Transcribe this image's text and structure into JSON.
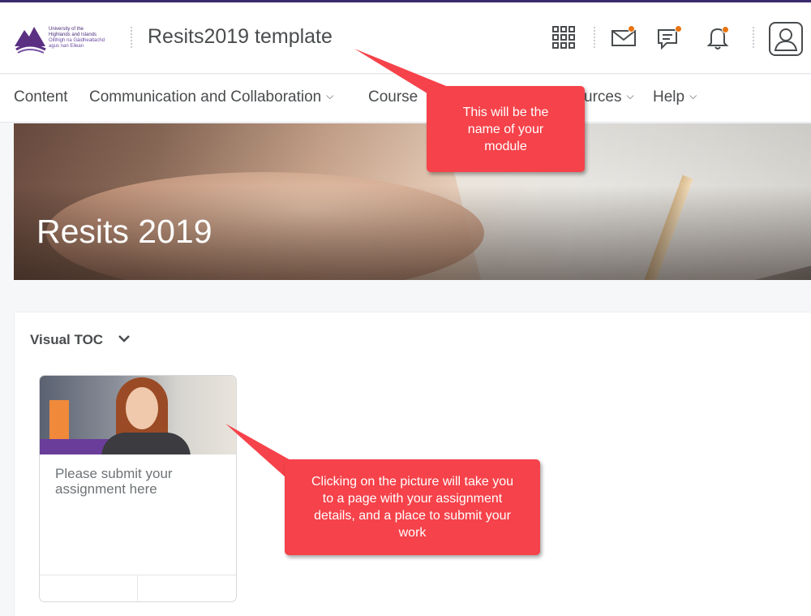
{
  "header": {
    "logo": {
      "line1": "University of the",
      "line2": "Highlands and Islands",
      "line3": "Oilthigh na Gàidhealtachd",
      "line4": "agus nan Eilean"
    },
    "course_title": "Resits2019 template",
    "icons": [
      "apps-grid-icon",
      "mail-icon",
      "chat-icon",
      "bell-icon",
      "user-icon"
    ],
    "notification_color": "#e87511"
  },
  "nav": {
    "items": [
      {
        "label": "Content",
        "dropdown": false
      },
      {
        "label": "Communication and Collaboration",
        "dropdown": true
      },
      {
        "label": "Course",
        "dropdown": false
      },
      {
        "label": "urces",
        "dropdown": true
      },
      {
        "label": "Help",
        "dropdown": true
      }
    ]
  },
  "banner": {
    "title": "Resits 2019"
  },
  "toc": {
    "label": "Visual TOC",
    "card": {
      "text": "Please submit your assignment here"
    }
  },
  "callouts": {
    "module_name": "This will be the name of your module",
    "picture_click": "Clicking on the picture will take you to a page with your assignment details, and a place to submit your work",
    "color": "#f6424a"
  }
}
